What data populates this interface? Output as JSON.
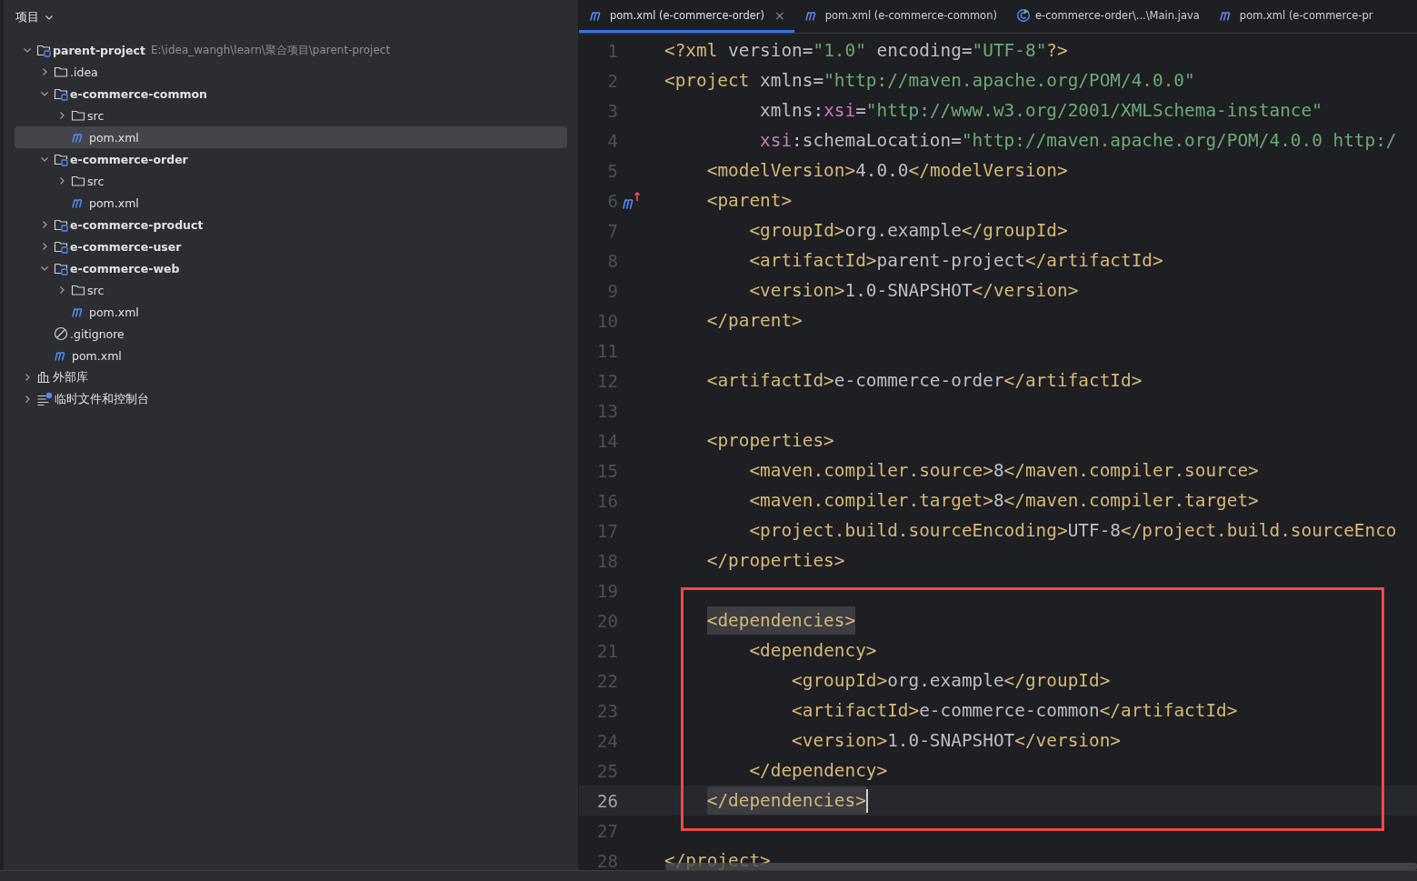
{
  "project_panel": {
    "title": "项目",
    "tree": [
      {
        "label": "parent-project",
        "hint": "E:\\idea_wangh\\learn\\聚合项目\\parent-project",
        "kind": "module",
        "expanded": true,
        "selected": false,
        "children": [
          {
            "label": ".idea",
            "kind": "folder",
            "expanded": false,
            "selected": false
          },
          {
            "label": "e-commerce-common",
            "kind": "module",
            "expanded": true,
            "selected": false,
            "children": [
              {
                "label": "src",
                "kind": "folder",
                "expanded": false,
                "selected": false
              },
              {
                "label": "pom.xml",
                "kind": "maven",
                "selected": true
              }
            ]
          },
          {
            "label": "e-commerce-order",
            "kind": "module",
            "expanded": true,
            "selected": false,
            "children": [
              {
                "label": "src",
                "kind": "folder",
                "expanded": false,
                "selected": false
              },
              {
                "label": "pom.xml",
                "kind": "maven",
                "selected": false
              }
            ]
          },
          {
            "label": "e-commerce-product",
            "kind": "module",
            "expanded": false,
            "selected": false
          },
          {
            "label": "e-commerce-user",
            "kind": "module",
            "expanded": false,
            "selected": false
          },
          {
            "label": "e-commerce-web",
            "kind": "module",
            "expanded": true,
            "selected": false,
            "children": [
              {
                "label": "src",
                "kind": "folder",
                "expanded": false,
                "selected": false
              },
              {
                "label": "pom.xml",
                "kind": "maven",
                "selected": false
              }
            ]
          },
          {
            "label": ".gitignore",
            "kind": "ignore",
            "selected": false
          },
          {
            "label": "pom.xml",
            "kind": "maven",
            "selected": false
          }
        ]
      },
      {
        "label": "外部库",
        "kind": "library",
        "expanded": false,
        "selected": false
      },
      {
        "label": "临时文件和控制台",
        "kind": "scratch",
        "expanded": false,
        "selected": false
      }
    ]
  },
  "tabs": [
    {
      "label": "pom.xml (e-commerce-order)",
      "kind": "maven",
      "selected": true,
      "close": "×"
    },
    {
      "label": "pom.xml (e-commerce-common)",
      "kind": "maven",
      "selected": false
    },
    {
      "label": "e-commerce-order\\...\\Main.java",
      "kind": "java",
      "selected": false
    },
    {
      "label": "pom.xml (e-commerce-pr",
      "kind": "maven",
      "selected": false
    }
  ],
  "editor": {
    "lines": [
      {
        "number": "1",
        "current": false,
        "tokens": [
          {
            "t": "<?xml ",
            "kind": "tag"
          },
          {
            "t": "version=",
            "kind": "text"
          },
          {
            "t": "\"1.0\"",
            "kind": "str"
          },
          {
            "t": " encoding=",
            "kind": "text"
          },
          {
            "t": "\"UTF-8\"",
            "kind": "str"
          },
          {
            "t": "?>",
            "kind": "tag"
          }
        ]
      },
      {
        "number": "2",
        "current": false,
        "tokens": [
          {
            "t": "<project ",
            "kind": "tag"
          },
          {
            "t": "xmlns=",
            "kind": "text"
          },
          {
            "t": "\"http://maven.apache.org/POM/4.0.0\"",
            "kind": "str"
          }
        ]
      },
      {
        "number": "3",
        "current": false,
        "tokens": [
          {
            "t": "         xmlns:",
            "kind": "text"
          },
          {
            "t": "xsi",
            "kind": "ns"
          },
          {
            "t": "=",
            "kind": "text"
          },
          {
            "t": "\"http://www.w3.org/2001/XMLSchema-instance\"",
            "kind": "str"
          }
        ]
      },
      {
        "number": "4",
        "current": false,
        "tokens": [
          {
            "t": "         xsi",
            "kind": "ns"
          },
          {
            "t": ":schemaLocation=",
            "kind": "text"
          },
          {
            "t": "\"http://maven.apache.org/POM/4.0.0 http:/",
            "kind": "str"
          }
        ]
      },
      {
        "number": "5",
        "current": false,
        "tokens": [
          {
            "t": "    <modelVersion>",
            "kind": "tag"
          },
          {
            "t": "4.0.0",
            "kind": "text"
          },
          {
            "t": "</modelVersion>",
            "kind": "tag"
          }
        ]
      },
      {
        "number": "6",
        "current": false,
        "gutter_icon": {
          "kind": "maven-parent"
        },
        "tokens": [
          {
            "t": "    <parent>",
            "kind": "tag"
          }
        ]
      },
      {
        "number": "7",
        "current": false,
        "tokens": [
          {
            "t": "        <groupId>",
            "kind": "tag"
          },
          {
            "t": "org.example",
            "kind": "text"
          },
          {
            "t": "</groupId>",
            "kind": "tag"
          }
        ]
      },
      {
        "number": "8",
        "current": false,
        "tokens": [
          {
            "t": "        <artifactId>",
            "kind": "tag"
          },
          {
            "t": "parent-project",
            "kind": "text"
          },
          {
            "t": "</artifactId>",
            "kind": "tag"
          }
        ]
      },
      {
        "number": "9",
        "current": false,
        "tokens": [
          {
            "t": "        <version>",
            "kind": "tag"
          },
          {
            "t": "1.0-SNAPSHOT",
            "kind": "text"
          },
          {
            "t": "</version>",
            "kind": "tag"
          }
        ]
      },
      {
        "number": "10",
        "current": false,
        "tokens": [
          {
            "t": "    </parent>",
            "kind": "tag"
          }
        ]
      },
      {
        "number": "11",
        "current": false
      },
      {
        "number": "12",
        "current": false,
        "tokens": [
          {
            "t": "    <artifactId>",
            "kind": "tag"
          },
          {
            "t": "e-commerce-order",
            "kind": "text"
          },
          {
            "t": "</artifactId>",
            "kind": "tag"
          }
        ]
      },
      {
        "number": "13",
        "current": false
      },
      {
        "number": "14",
        "current": false,
        "tokens": [
          {
            "t": "    <properties>",
            "kind": "tag"
          }
        ]
      },
      {
        "number": "15",
        "current": false,
        "tokens": [
          {
            "t": "        <maven.compiler.source>",
            "kind": "tag"
          },
          {
            "t": "8",
            "kind": "text"
          },
          {
            "t": "</maven.compiler.source>",
            "kind": "tag"
          }
        ]
      },
      {
        "number": "16",
        "current": false,
        "tokens": [
          {
            "t": "        <maven.compiler.target>",
            "kind": "tag"
          },
          {
            "t": "8",
            "kind": "text"
          },
          {
            "t": "</maven.compiler.target>",
            "kind": "tag"
          }
        ]
      },
      {
        "number": "17",
        "current": false,
        "tokens": [
          {
            "t": "        <project.build.sourceEncoding>",
            "kind": "tag"
          },
          {
            "t": "UTF-8",
            "kind": "text"
          },
          {
            "t": "</project.build.sourceEnco",
            "kind": "tag"
          }
        ]
      },
      {
        "number": "18",
        "current": false,
        "tokens": [
          {
            "t": "    </properties>",
            "kind": "tag"
          }
        ]
      },
      {
        "number": "19",
        "current": false
      },
      {
        "number": "20",
        "current": false,
        "tokens": [
          {
            "t": "    <dependencies>",
            "kind": "match"
          }
        ]
      },
      {
        "number": "21",
        "current": false,
        "tokens": [
          {
            "t": "        <dependency>",
            "kind": "tag"
          }
        ]
      },
      {
        "number": "22",
        "current": false,
        "tokens": [
          {
            "t": "            <groupId>",
            "kind": "tag"
          },
          {
            "t": "org.example",
            "kind": "text"
          },
          {
            "t": "</groupId>",
            "kind": "tag"
          }
        ]
      },
      {
        "number": "23",
        "current": false,
        "tokens": [
          {
            "t": "            <artifactId>",
            "kind": "tag"
          },
          {
            "t": "e-commerce-common",
            "kind": "text"
          },
          {
            "t": "</artifactId>",
            "kind": "tag"
          }
        ]
      },
      {
        "number": "24",
        "current": false,
        "tokens": [
          {
            "t": "            <version>",
            "kind": "tag"
          },
          {
            "t": "1.0-SNAPSHOT",
            "kind": "text"
          },
          {
            "t": "</version>",
            "kind": "tag"
          }
        ]
      },
      {
        "number": "25",
        "current": false,
        "tokens": [
          {
            "t": "        </dependency>",
            "kind": "tag"
          }
        ]
      },
      {
        "number": "26",
        "current": true,
        "tokens": [
          {
            "t": "    </dependencies>",
            "kind": "match"
          }
        ]
      },
      {
        "number": "27",
        "current": false
      },
      {
        "number": "28",
        "current": false,
        "tokens": [
          {
            "t": "</project>",
            "kind": "tag"
          }
        ]
      }
    ]
  }
}
